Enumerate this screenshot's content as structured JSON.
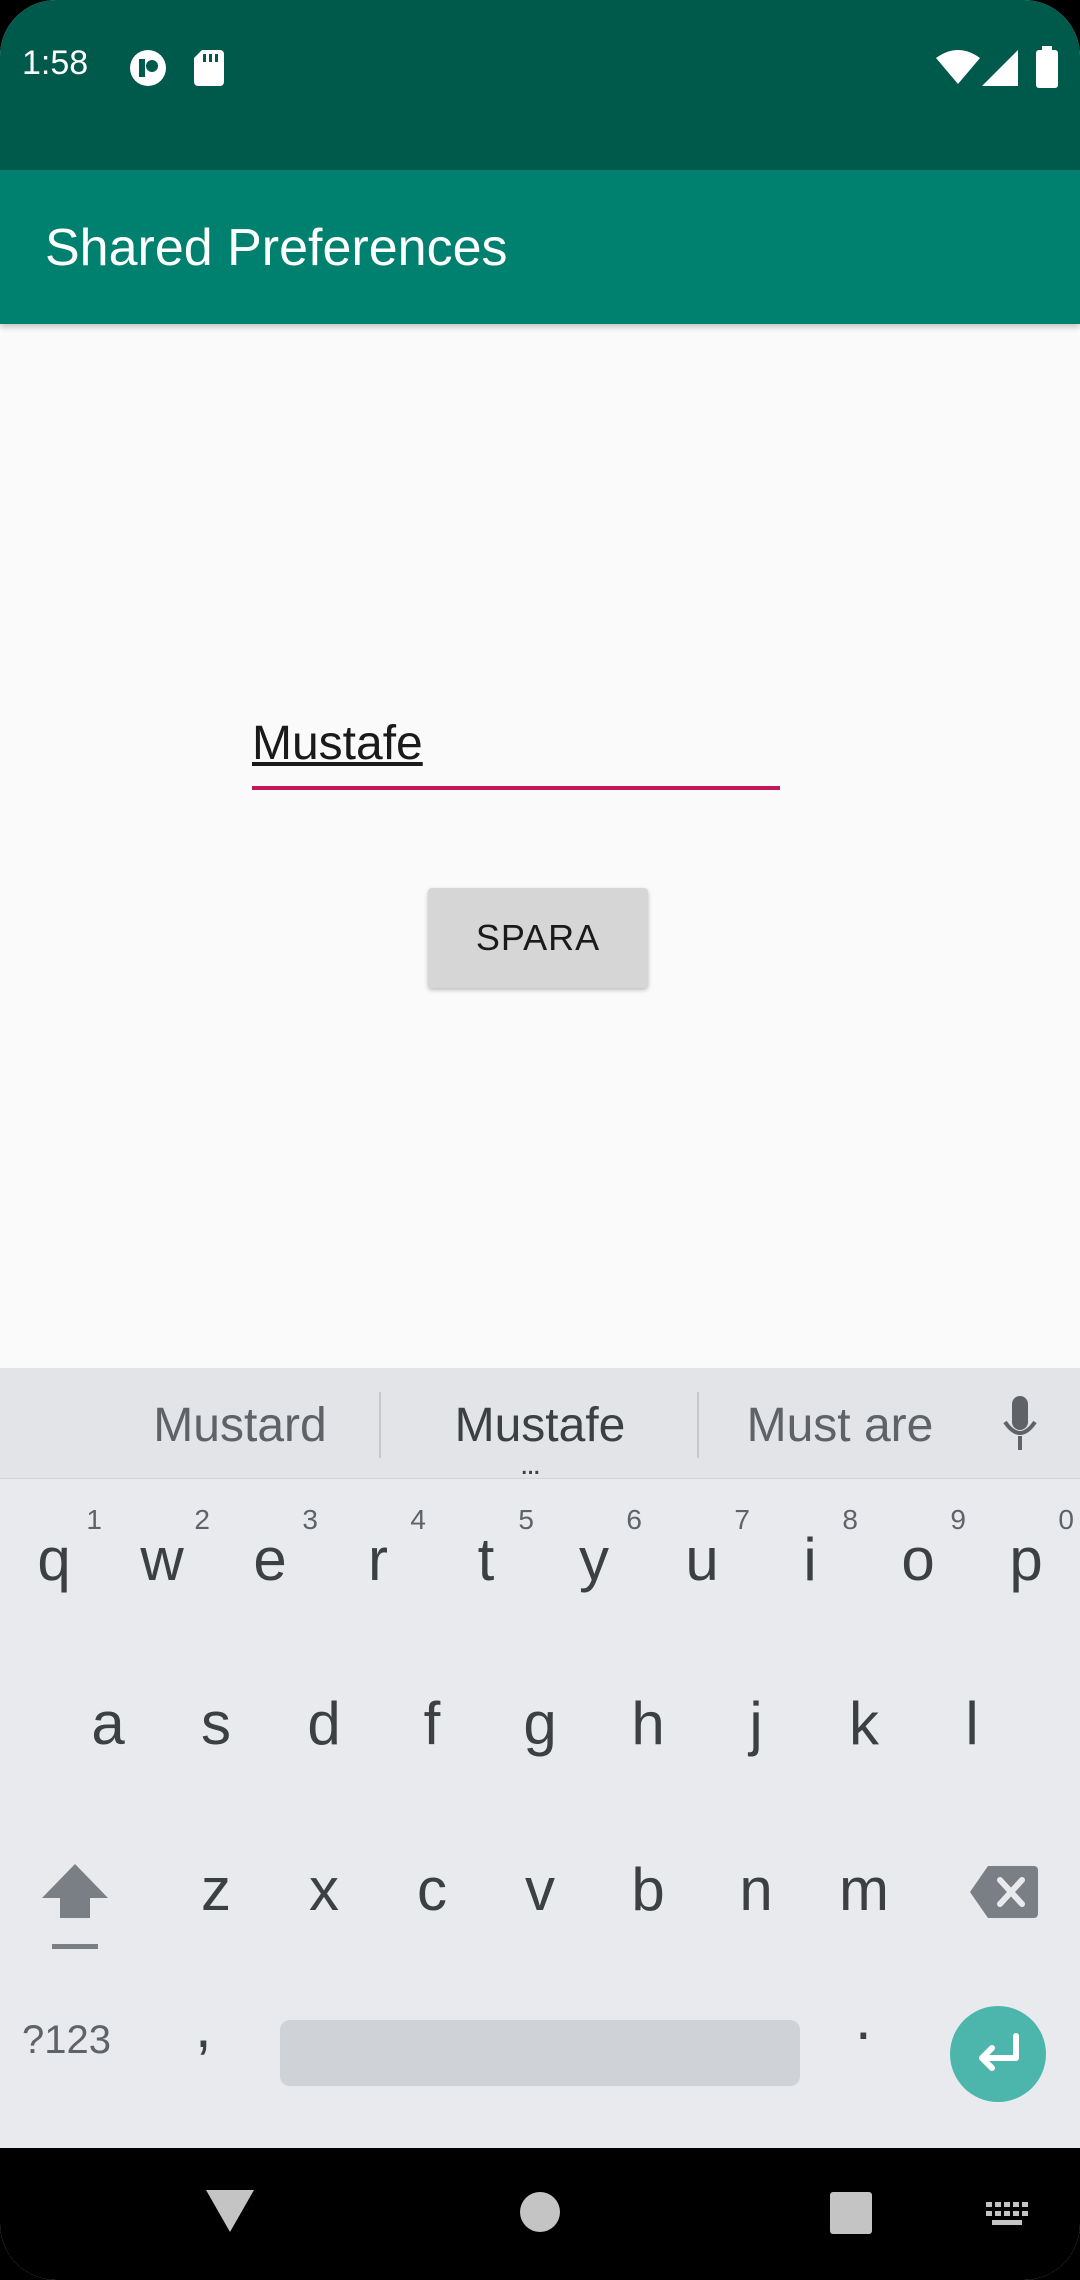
{
  "status_bar": {
    "time": "1:58",
    "icons": [
      "notification-app-icon",
      "sd-card-icon",
      "wifi-icon",
      "signal-icon",
      "battery-icon"
    ]
  },
  "app_bar": {
    "title": "Shared Preferences",
    "color": "#00806e"
  },
  "form": {
    "name_value": "Mustafe",
    "input_underline_color": "#c2185b",
    "save_label": "SPARA"
  },
  "keyboard": {
    "suggestions": [
      "Mustard",
      "Mustafe",
      "Must are"
    ],
    "more_suggestions": "...",
    "row1": [
      "q",
      "w",
      "e",
      "r",
      "t",
      "y",
      "u",
      "i",
      "o",
      "p"
    ],
    "row1_hints": [
      "1",
      "2",
      "3",
      "4",
      "5",
      "6",
      "7",
      "8",
      "9",
      "0"
    ],
    "row2": [
      "a",
      "s",
      "d",
      "f",
      "g",
      "h",
      "j",
      "k",
      "l"
    ],
    "row3": [
      "z",
      "x",
      "c",
      "v",
      "b",
      "n",
      "m"
    ],
    "symbols_label": "?123",
    "comma_label": ",",
    "period_label": ".",
    "enter_color": "#4db6ac"
  },
  "nav_bar": {
    "icons": [
      "back-icon",
      "home-icon",
      "recents-icon",
      "keyboard-switch-icon"
    ]
  }
}
